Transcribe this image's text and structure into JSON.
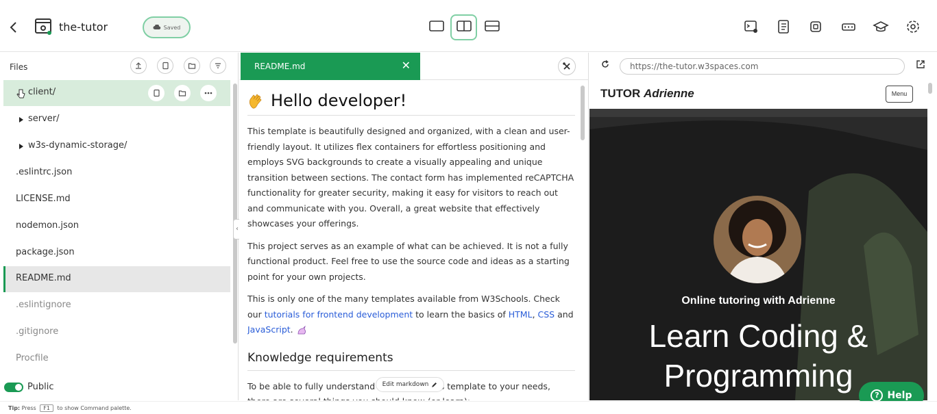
{
  "header": {
    "project_name": "the-tutor",
    "saved_label": "Saved",
    "layouts": [
      "single-pane-icon",
      "split-vertical-icon",
      "split-horizontal-icon"
    ],
    "active_layout": "split-vertical-icon",
    "right_icons": [
      "terminal-icon",
      "log-icon",
      "chip-icon",
      "ram-icon",
      "graduation-cap-icon",
      "gear-icon"
    ]
  },
  "files": {
    "title": "Files",
    "items": [
      {
        "label": "client/",
        "type": "folder",
        "state": "hovered"
      },
      {
        "label": "server/",
        "type": "folder"
      },
      {
        "label": "w3s-dynamic-storage/",
        "type": "folder"
      },
      {
        "label": ".eslintrc.json",
        "type": "file"
      },
      {
        "label": "LICENSE.md",
        "type": "file"
      },
      {
        "label": "nodemon.json",
        "type": "file"
      },
      {
        "label": "package.json",
        "type": "file"
      },
      {
        "label": "README.md",
        "type": "file",
        "state": "selected"
      },
      {
        "label": ".eslintignore",
        "type": "file",
        "dimmed": true
      },
      {
        "label": ".gitignore",
        "type": "file",
        "dimmed": true
      },
      {
        "label": "Procfile",
        "type": "file",
        "dimmed": true
      }
    ],
    "public_label": "Public"
  },
  "editor": {
    "tab_label": "README.md",
    "heading": "Hello developer!",
    "p1": "This template is beautifully designed and organized, with a clean and user-friendly layout. It utilizes flex containers for effortless positioning and employs SVG backgrounds to create a visually appealing and unique transition between sections. The contact form has implemented reCAPTCHA functionality for greater security, making it easy for visitors to reach out and communicate with you. Overall, a great website that effectively showcases your offerings.",
    "p2": "This project serves as an example of what can be achieved. It is not a fully functional product. Feel free to use the source code and ideas as a starting point for your own projects.",
    "p3_pre": "This is only one of the many templates available from W3Schools. Check our ",
    "p3_link1": "tutorials for frontend development",
    "p3_mid": " to learn the basics of ",
    "p3_link2": "HTML",
    "p3_comma": ", ",
    "p3_link3": "CSS",
    "p3_and": " and ",
    "p3_link4": "JavaScript",
    "p3_end": ".",
    "h2": "Knowledge requirements",
    "p4": "To be able to fully understand and modify this template to your needs, there are several things you should know (or learn):",
    "edit_markdown": "Edit markdown"
  },
  "preview": {
    "url": "https://the-tutor.w3spaces.com",
    "brand_prefix": "TUTOR",
    "brand_name": "Adrienne",
    "menu_label": "Menu",
    "tagline": "Online tutoring with Adrienne",
    "hero_line1": "Learn Coding &",
    "hero_line2": "Programming"
  },
  "help_label": "Help",
  "footer": {
    "tip_label": "Tip:",
    "tip_pre": "Press",
    "tip_key": "F1",
    "tip_post": "to show Command palette."
  },
  "colors": {
    "accent": "#1a9a54",
    "accent_light": "#d8ecdc",
    "link": "#2a5dd8"
  }
}
